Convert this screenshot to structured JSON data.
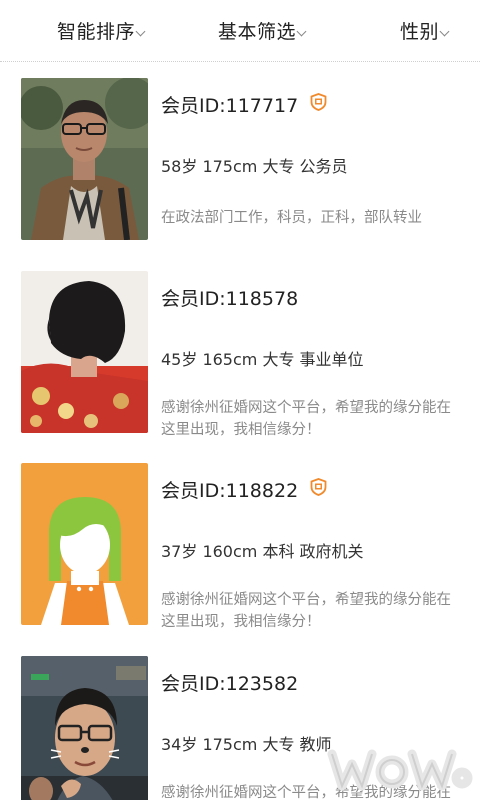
{
  "filters": {
    "sort_label": "智能排序",
    "basic_label": "基本筛选",
    "gender_label": "性别"
  },
  "members": [
    {
      "id_text": "会员ID:117717",
      "verified": true,
      "info": "58岁 175cm 大专 公务员",
      "desc": "在政法部门工作，科员，正科，部队转业"
    },
    {
      "id_text": "会员ID:118578",
      "verified": false,
      "info": "45岁 165cm 大专 事业单位",
      "desc": "感谢徐州征婚网这个平台，希望我的缘分能在这里出现，我相信缘分！"
    },
    {
      "id_text": "会员ID:118822",
      "verified": true,
      "info": "37岁 160cm 本科 政府机关",
      "desc": "感谢徐州征婚网这个平台，希望我的缘分能在这里出现，我相信缘分！"
    },
    {
      "id_text": "会员ID:123582",
      "verified": false,
      "info": "34岁 175cm 大专 教师",
      "desc": "感谢徐州征婚网这个平台，希望我的缘分能在这里出现，我相信缘分！"
    }
  ],
  "colors": {
    "badge": "#f08a2c",
    "text_primary": "#222222",
    "text_secondary": "#8a8a8a"
  },
  "icons": {
    "badge": "verified-badge-icon",
    "caret": "chevron-down-icon"
  }
}
